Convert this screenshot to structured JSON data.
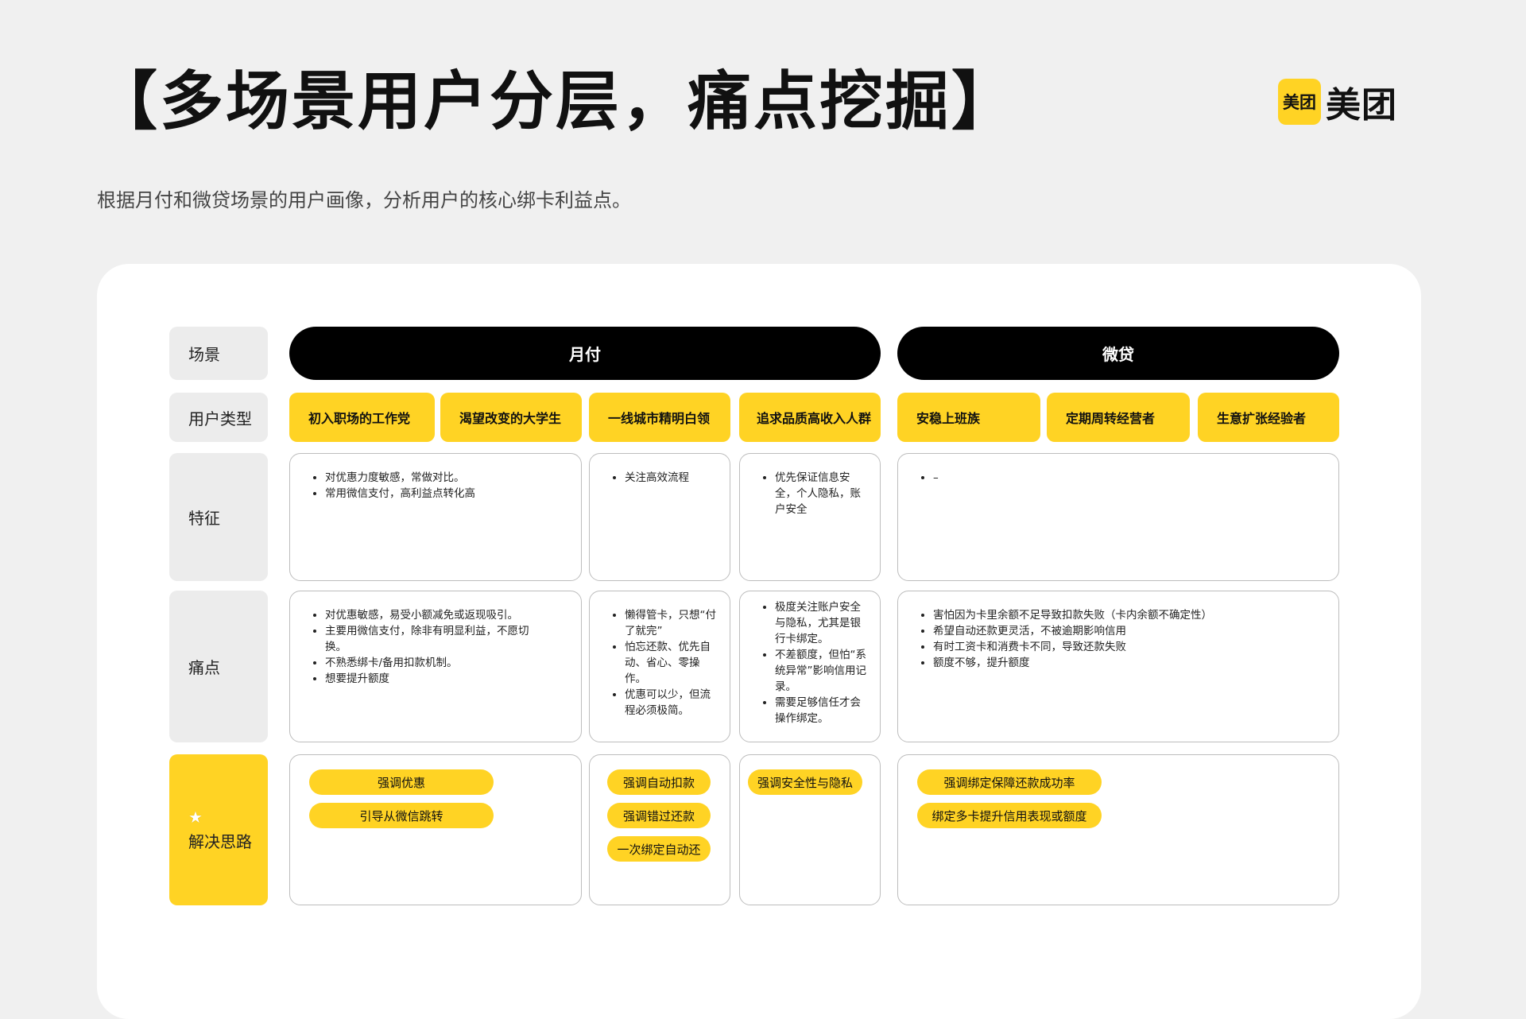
{
  "header": {
    "title": "【多场景用户分层，痛点挖掘】",
    "subtitle": "根据月付和微贷场景的用户画像，分析用户的核心绑卡利益点。",
    "logo_mark": "美团",
    "logo_text": "美团",
    "logo_color": "#ffd324"
  },
  "row_labels": {
    "scene": "场景",
    "user_type": "用户类型",
    "features": "特征",
    "pain_points": "痛点",
    "solutions": "解决思路",
    "solutions_icon": "star-icon"
  },
  "scenes": [
    {
      "label": "月付"
    },
    {
      "label": "微贷"
    }
  ],
  "user_types": [
    "初入职场的工作党",
    "渴望改变的大学生",
    "一线城市精明白领",
    "追求品质高收入人群",
    "安稳上班族",
    "定期周转经营者",
    "生意扩张经验者"
  ],
  "features": {
    "g1": [
      "对优惠力度敏感，常做对比。",
      "常用微信支付，高利益点转化高"
    ],
    "g2": [
      "关注高效流程"
    ],
    "g3": [
      "优先保证信息安全，个人隐私，账户安全"
    ],
    "g4": [
      "–"
    ]
  },
  "pain_points": {
    "g1": [
      "对优惠敏感，易受小额减免或返现吸引。",
      "主要用微信支付，除非有明显利益，不愿切换。",
      "不熟悉绑卡/备用扣款机制。",
      "想要提升额度"
    ],
    "g2": [
      "懒得管卡，只想“付了就完”",
      "怕忘还款、优先自动、省心、零操作。",
      "优惠可以少，但流程必须极简。"
    ],
    "g3": [
      "极度关注账户安全与隐私，尤其是银行卡绑定。",
      "不差额度，但怕“系统异常”影响信用记录。",
      "需要足够信任才会操作绑定。"
    ],
    "g4": [
      "害怕因为卡里余额不足导致扣款失败（卡内余额不确定性）",
      "希望自动还款更灵活，不被逾期影响信用",
      "有时工资卡和消费卡不同，导致还款失败",
      "额度不够，提升额度"
    ]
  },
  "solutions": {
    "g1": [
      "强调优惠",
      "引导从微信跳转"
    ],
    "g2": [
      "强调自动扣款",
      "强调错过还款",
      "一次绑定自动还"
    ],
    "g3": [
      "强调安全性与隐私"
    ],
    "g4": [
      "强调绑定保障还款成功率",
      "绑定多卡提升信用表现或额度"
    ]
  }
}
